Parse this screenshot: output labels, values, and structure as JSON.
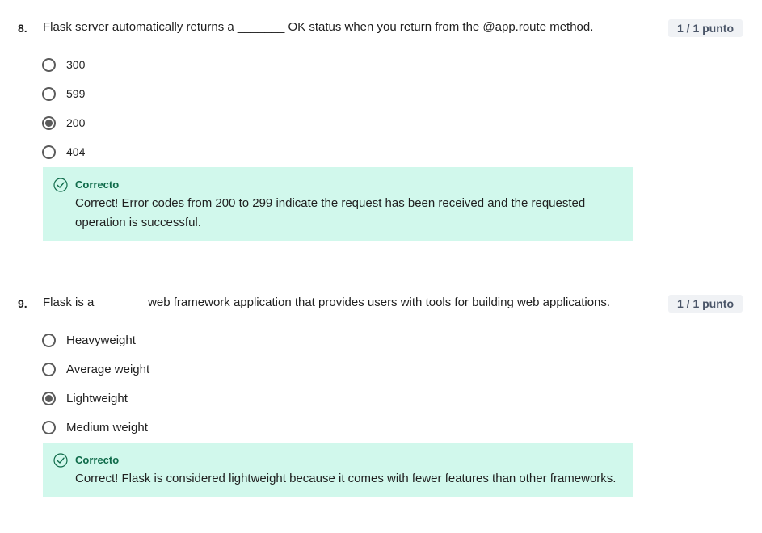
{
  "questions": [
    {
      "number": "8.",
      "text": "Flask server automatically returns a _______ OK status when you return from the @app.route method.",
      "points": "1 / 1 punto",
      "options": [
        {
          "label": "300",
          "selected": false
        },
        {
          "label": "599",
          "selected": false
        },
        {
          "label": "200",
          "selected": true
        },
        {
          "label": "404",
          "selected": false
        }
      ],
      "feedback": {
        "title": "Correcto",
        "text": "Correct! Error codes from 200 to 299 indicate the request has been received and the requested operation is successful."
      }
    },
    {
      "number": "9.",
      "text": "Flask is a _______ web framework application that provides users with tools for building web applications.",
      "points": "1 / 1 punto",
      "options": [
        {
          "label": "Heavyweight",
          "selected": false
        },
        {
          "label": "Average weight",
          "selected": false
        },
        {
          "label": "Lightweight",
          "selected": true
        },
        {
          "label": "Medium weight",
          "selected": false
        }
      ],
      "feedback": {
        "title": "Correcto",
        "text": "Correct! Flask is considered lightweight because it comes with fewer features than other frameworks."
      }
    }
  ],
  "colors": {
    "feedback_bg": "#d1f8ec",
    "feedback_title": "#0f6b4a",
    "radio": "#5b5b5b",
    "points_bg": "#f0f2f5"
  },
  "icons": {
    "feedback": "check-circle-icon",
    "radio": "radio-button-icon"
  }
}
